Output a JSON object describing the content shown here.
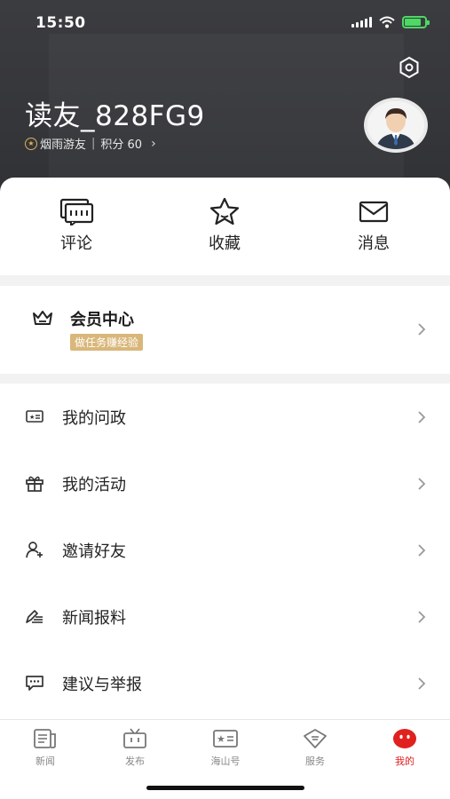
{
  "status_bar": {
    "time": "15:50"
  },
  "profile": {
    "username": "读友_828FG9",
    "level": "烟雨游友",
    "separator": "|",
    "points_label": "积分 60",
    "chevron": "›"
  },
  "quick_actions": [
    {
      "label": "评论",
      "icon": "comment-icon"
    },
    {
      "label": "收藏",
      "icon": "star-icon"
    },
    {
      "label": "消息",
      "icon": "mail-icon"
    }
  ],
  "member": {
    "title": "会员中心",
    "tag": "做任务赚经验",
    "icon": "crown-icon"
  },
  "menu": [
    {
      "label": "我的问政",
      "icon": "id-card-icon"
    },
    {
      "label": "我的活动",
      "icon": "gift-icon"
    },
    {
      "label": "邀请好友",
      "icon": "add-user-icon"
    },
    {
      "label": "新闻报料",
      "icon": "edit-icon"
    },
    {
      "label": "建议与举报",
      "icon": "feedback-icon"
    }
  ],
  "tabbar": [
    {
      "label": "新闻",
      "icon": "news-icon"
    },
    {
      "label": "发布",
      "icon": "tv-icon"
    },
    {
      "label": "海山号",
      "icon": "profile-card-icon"
    },
    {
      "label": "服务",
      "icon": "service-icon"
    },
    {
      "label": "我的",
      "icon": "me-icon",
      "active": true
    }
  ],
  "colors": {
    "accent": "#e0211e",
    "gold": "#d9b77a",
    "header_bg": "#36373b"
  }
}
